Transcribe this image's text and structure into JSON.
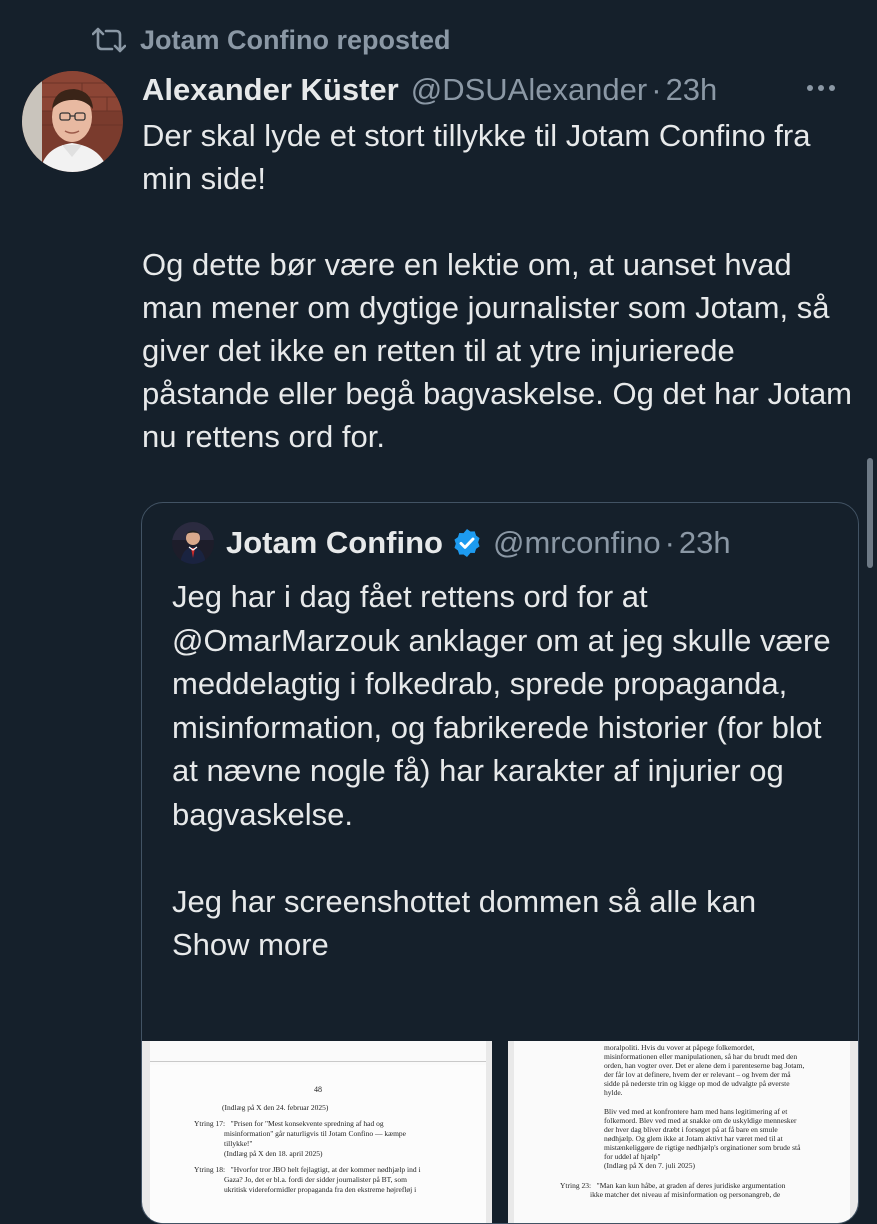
{
  "repost": {
    "icon": "repost-icon",
    "label": "Jotam Confino reposted"
  },
  "tweet": {
    "author_name": "Alexander Küster",
    "handle": "@DSUAlexander",
    "separator": "·",
    "time": "23h",
    "more_icon": "more-icon",
    "text": "Der skal lyde et stort tillykke til Jotam Confino fra min side!\n\nOg dette bør være en lektie om, at uanset hvad man mener om dygtige journalister som Jotam, så giver det ikke en retten til at ytre injurierede påstande eller begå bagvaskelse. Og det har Jotam nu rettens ord for."
  },
  "quote": {
    "author_name": "Jotam Confino",
    "verified_icon": "verified-badge-icon",
    "handle": "@mrconfino",
    "separator": "·",
    "time": "23h",
    "text": "Jeg har i dag fået rettens ord for at @OmarMarzouk anklager om at jeg skulle være meddelagtig i folkedrab, sprede propaganda, misinformation, og fabrikerede historier (for blot at nævne nogle få) har karakter af injurier og bagvaskelse.\n\nJeg har screenshottet dommen så alle kan ",
    "show_more": "Show more"
  },
  "document_left": {
    "page_number": "48",
    "lines": [
      "(Indlæg på X den 24. februar 2025)",
      "Ytring 17:   \"Prisen for \"Mest konsekvente spredning af had og",
      "                misinformation\" går naturligvis til Jotam Confino — kæmpe",
      "                tillykke!\"",
      "                (Indlæg på X den 18. april 2025)",
      "Ytring 18:   \"Hvorfor tror JBO helt fejlagtigt, at der kommer nødhjælp ind i",
      "                Gaza? Jo, det er bl.a. fordi der sidder journalister på BT, som",
      "                ukritisk videreformidler propaganda fra den ekstreme højrefløj i"
    ]
  },
  "document_right": {
    "lines": [
      "moralpoliti. Hvis du vover at påpege folkemordet,",
      "misinformationen eller manipulationen, så har du brudt med den",
      "orden, han vogter over. Det er alene dem i parenteserne bag Jotam,",
      "der får lov at definere, hvem der er relevant – og hvem der må",
      "sidde på nederste trin og kigge op mod de udvalgte på øverste",
      "hylde.",
      "",
      "Bliv ved med at konfrontere ham med hans legitimering af et",
      "folkemord. Blev ved med at snakke om de uskyldige mennesker",
      "der hver dag bliver dræbt i forsøget på at få bare en smule",
      "nødhjælp. Og glem ikke at Jotam aktivt har været med til at",
      "mistænkeliggøre de rigtige nødhjælp's orginationer som brude stå",
      "for uddel af hjælp\"",
      "(Indlæg på X den 7. juli 2025)",
      "",
      "Ytring 23:   \"Man kan kun håbe, at graden af deres juridiske argumentation",
      "                ikke matcher det niveau af misinformation og personangreb, de"
    ]
  }
}
